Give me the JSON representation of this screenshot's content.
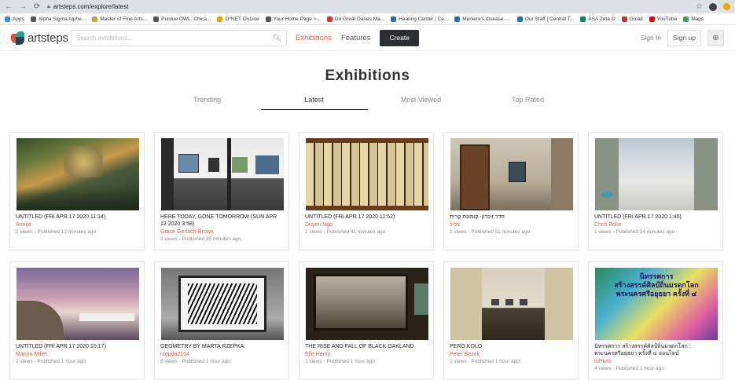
{
  "browser": {
    "url": "artsteps.com/explore/latest",
    "bookmarks": [
      {
        "label": "Apps",
        "color": "#4285f4"
      },
      {
        "label": "Alpha Sigma Alphe...",
        "color": "#555"
      },
      {
        "label": "Master of Fine Arts...",
        "color": "#c9a227"
      },
      {
        "label": "Purdue OWL: Chica...",
        "color": "#555"
      },
      {
        "label": "O*NET OnLine",
        "color": "#e8a200"
      },
      {
        "label": "Your Home Page >...",
        "color": "#555"
      },
      {
        "label": "Do Great Danes Ma...",
        "color": "#d33"
      },
      {
        "label": "Hearing Center | Ce...",
        "color": "#2a6ebb"
      },
      {
        "label": "Meniere's disease -...",
        "color": "#2a6ebb"
      },
      {
        "label": "Our Staff | Central T...",
        "color": "#2a6ebb"
      },
      {
        "label": "ASA Zeta O",
        "color": "#0a8a5a"
      },
      {
        "label": "Gmail",
        "color": "#d93025"
      },
      {
        "label": "YouTube",
        "color": "#e00"
      },
      {
        "label": "Maps",
        "color": "#34a853"
      }
    ]
  },
  "header": {
    "logo_text": "artsteps",
    "search_placeholder": "Search exhibitions...",
    "nav_exhibitions": "Exhibitions",
    "nav_features": "Features",
    "create_label": "Create",
    "sign_in": "Sign In",
    "sign_up": "Sign up"
  },
  "page": {
    "title": "Exhibitions",
    "tabs": [
      "Trending",
      "Latest",
      "Most Viewed",
      "Top Rated"
    ],
    "active_tab": "Latest"
  },
  "exhibitions": [
    {
      "title": "UNTITLED (FRI APR 17 2020 11:14)",
      "author": "Annija",
      "meta": "2 views - Published 12 minutes ago"
    },
    {
      "title": "HERE TODAY, GONE TOMORROW (SUN APR 12 2020 3:58)",
      "author": "Grace Gerlach-Brown",
      "meta": "2 views - Published 35 minutes ago"
    },
    {
      "title": "UNTITLED (FRI APR 17 2020 11:52)",
      "author": "Duyen Ngo",
      "meta": "2 views - Published 41 minutes ago"
    },
    {
      "title": "חדר זיכרון- קומונת קרית",
      "author": "צליל",
      "meta": "2 views - Published 52 minutes ago"
    },
    {
      "title": "UNTITLED (FRI APR 17 2020 1:40)",
      "author": "Chris Bolor",
      "meta": "1 views - Published 54 minutes ago"
    },
    {
      "title": "UNTITLED (FRI APR 17 2020 10:17)",
      "author": "Manon Millet",
      "meta": "2 views - Published 1 hour ago"
    },
    {
      "title": "GEOMETRY BY MARTA RZEPKA",
      "author": "rzepda2104",
      "meta": "6 views - Published 1 hour ago"
    },
    {
      "title": "THE RISE AND FALL OF BLACK OAKLAND",
      "author": "Elle Henry",
      "meta": "1 views - Published 1 hour ago"
    },
    {
      "title": "PERO KOLO",
      "author": "Peter Bezek",
      "meta": "1 views - Published 1 hour ago"
    },
    {
      "title": "นิทรรศการ สร้างสรรค์ศิลป์ถิ่นมรดกโลก : พระนครศรีอยุธยา ครั้งที่ ๔ ออนไลน์",
      "author": "tuPluto",
      "meta": "4 views - Published 1 hour ago"
    }
  ],
  "thumb_text": {
    "thai_line1": "นิทรรศการ",
    "thai_line2": "สร้างสรรค์ศิลป์ถิ่นมรดกโลก",
    "thai_line3": "พระนครศรีอยุธยา ครั้งที่ ๔"
  },
  "colors": {
    "accent": "#e55b4d",
    "create_bg": "#2b2f33"
  }
}
